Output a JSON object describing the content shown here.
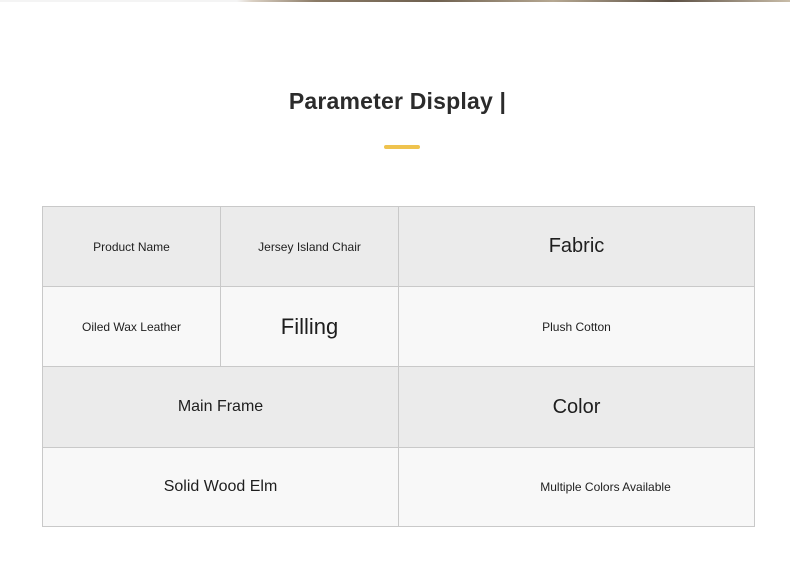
{
  "header": {
    "title": "Parameter Display |"
  },
  "table": {
    "row1": {
      "product_name_label": "Product Name",
      "product_name_value": "Jersey Island Chair",
      "fabric_label": "Fabric"
    },
    "row2": {
      "fabric_value": "Oiled Wax Leather",
      "filling_label": "Filling",
      "filling_value": "Plush Cotton"
    },
    "row3": {
      "main_frame_label": "Main Frame",
      "color_label": "Color"
    },
    "row4": {
      "main_frame_value": "Solid Wood Elm",
      "color_value": "Multiple Colors Available"
    }
  },
  "colors": {
    "accent": "#efc34e",
    "shaded_cell": "#ebebeb",
    "light_cell": "#f8f8f8",
    "border": "#c9c9c9",
    "text": "#1e1e1e"
  }
}
